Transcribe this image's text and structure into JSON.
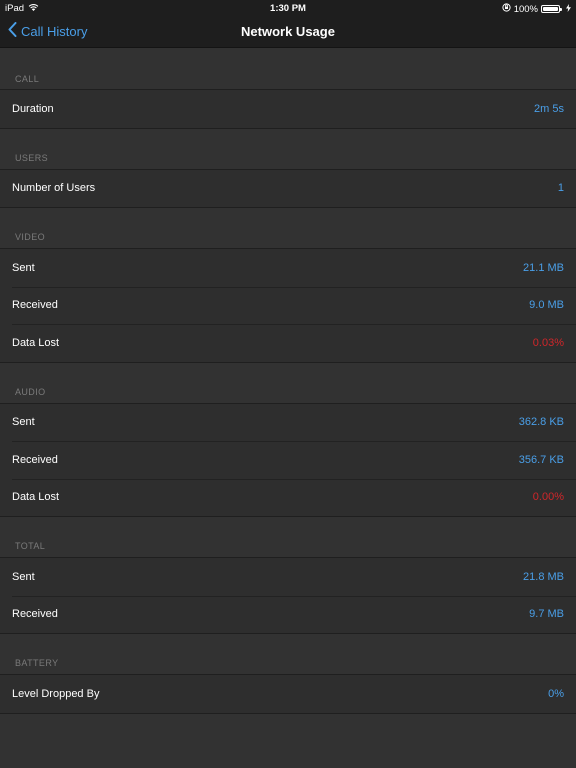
{
  "status_bar": {
    "device": "iPad",
    "time": "1:30 PM",
    "battery_percent": "100%",
    "icons": [
      "wifi-icon",
      "rotation-lock-icon",
      "battery-icon",
      "charging-icon"
    ]
  },
  "nav": {
    "back_label": "Call History",
    "title": "Network Usage"
  },
  "colors": {
    "accent": "#4a9fe8",
    "alert": "#d0262a",
    "background": "#323232",
    "row_background": "#2e2e2e"
  },
  "sections": [
    {
      "header": "CALL",
      "rows": [
        {
          "label": "Duration",
          "value": "2m 5s"
        }
      ]
    },
    {
      "header": "USERS",
      "rows": [
        {
          "label": "Number of Users",
          "value": "1"
        }
      ]
    },
    {
      "header": "VIDEO",
      "rows": [
        {
          "label": "Sent",
          "value": "21.1 MB"
        },
        {
          "label": "Received",
          "value": "9.0 MB"
        },
        {
          "label": "Data Lost",
          "value": "0.03%"
        }
      ]
    },
    {
      "header": "AUDIO",
      "rows": [
        {
          "label": "Sent",
          "value": "362.8 KB"
        },
        {
          "label": "Received",
          "value": "356.7 KB"
        },
        {
          "label": "Data Lost",
          "value": "0.00%"
        }
      ]
    },
    {
      "header": "TOTAL",
      "rows": [
        {
          "label": "Sent",
          "value": "21.8 MB"
        },
        {
          "label": "Received",
          "value": "9.7 MB"
        }
      ]
    },
    {
      "header": "BATTERY",
      "rows": [
        {
          "label": "Level Dropped By",
          "value": "0%"
        }
      ]
    }
  ]
}
